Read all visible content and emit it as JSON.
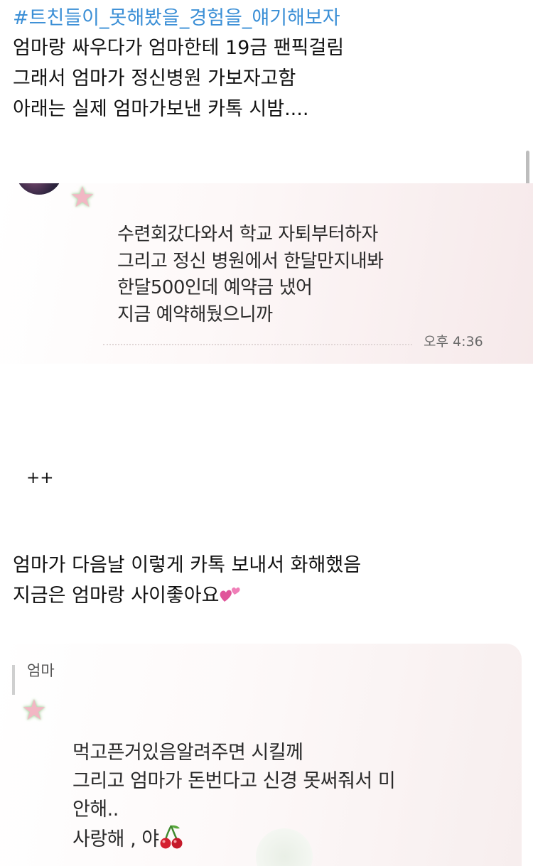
{
  "post": {
    "hashtag": "#트친들이_못해봤을_경험을_얘기해보자",
    "lines": [
      "엄마랑 싸우다가 엄마한테 19금 팬픽걸림",
      "그래서 엄마가 정신병원 가보자고함",
      "아래는 실제 엄마가보낸 카톡 시밤...."
    ]
  },
  "screenshot1": {
    "messages": [
      "수련회갔다와서 학교 자퇴부터하자",
      "그리고 정신 병원에서 한달만지내봐",
      "한달500인데 예약금 냈어",
      "지금 예약해뒀으니까"
    ],
    "time": "오후 4:36"
  },
  "separator": "++",
  "post2": {
    "lines": [
      "엄마가 다음날 이렇게 카톡 보내서 화해했음",
      "지금은 엄마랑 사이좋아요"
    ]
  },
  "screenshot2": {
    "sender": "엄마",
    "messages": [
      "먹고픈거있음알려주면 시킬께",
      "그리고 엄마가 돈번다고  신경 못써줘서 미",
      "안해..",
      "사랑해 ,     야"
    ]
  },
  "icons": {
    "heart": "two-hearts-icon",
    "cherry": "cherry-icon",
    "star": "star-icon"
  },
  "colors": {
    "hashtag": "#3b8fd6",
    "text": "#111111",
    "chat_bg": "#f6e9ea"
  }
}
